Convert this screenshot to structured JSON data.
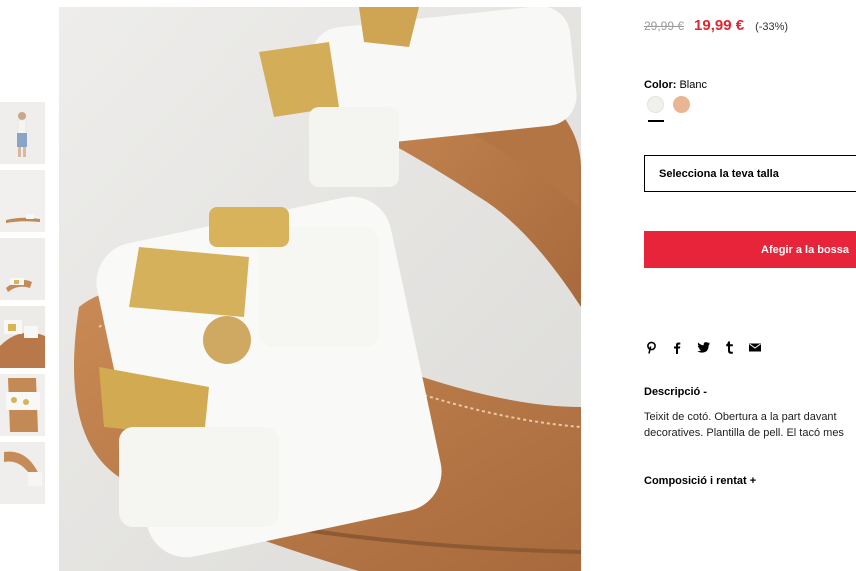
{
  "pricing": {
    "original_price": "29,99 €",
    "sale_price": "19,99 €",
    "discount": "(-33%)"
  },
  "color": {
    "label": "Color:",
    "value": "Blanc",
    "swatches": [
      "#f1f0ea",
      "#e9b592"
    ]
  },
  "size_select": {
    "placeholder": "Selecciona la teva talla"
  },
  "add_to_bag": {
    "label": "Afegir a la bossa"
  },
  "share": {
    "icons": [
      "pinterest-icon",
      "facebook-icon",
      "twitter-icon",
      "tumblr-icon",
      "mail-icon"
    ]
  },
  "description": {
    "title": "Descripció  -",
    "line1": "Teixit de cotó. Obertura a la part davant",
    "line2": "decoratives. Plantilla de pell. El tacó mes"
  },
  "composition": {
    "title": "Composició i rentat  +"
  }
}
